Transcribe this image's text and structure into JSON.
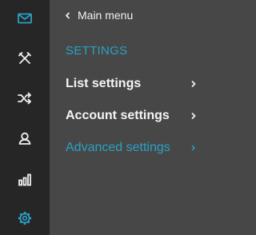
{
  "colors": {
    "accent": "#2aa1c6",
    "rail_background": "#262626",
    "panel_background": "#474747",
    "text": "#f5f5f5",
    "icon_inactive": "#f0f0f0"
  },
  "rail": {
    "items": [
      {
        "icon": "envelope-icon",
        "active": true
      },
      {
        "icon": "tools-icon",
        "active": false
      },
      {
        "icon": "shuffle-icon",
        "active": false
      },
      {
        "icon": "user-icon",
        "active": false
      },
      {
        "icon": "bar-chart-icon",
        "active": false
      },
      {
        "icon": "gear-icon",
        "active": true
      }
    ]
  },
  "panel": {
    "back_label": "Main menu",
    "section_title": "SETTINGS",
    "items": [
      {
        "label": "List settings",
        "active": false
      },
      {
        "label": "Account settings",
        "active": false
      },
      {
        "label": "Advanced settings",
        "active": true
      }
    ]
  }
}
